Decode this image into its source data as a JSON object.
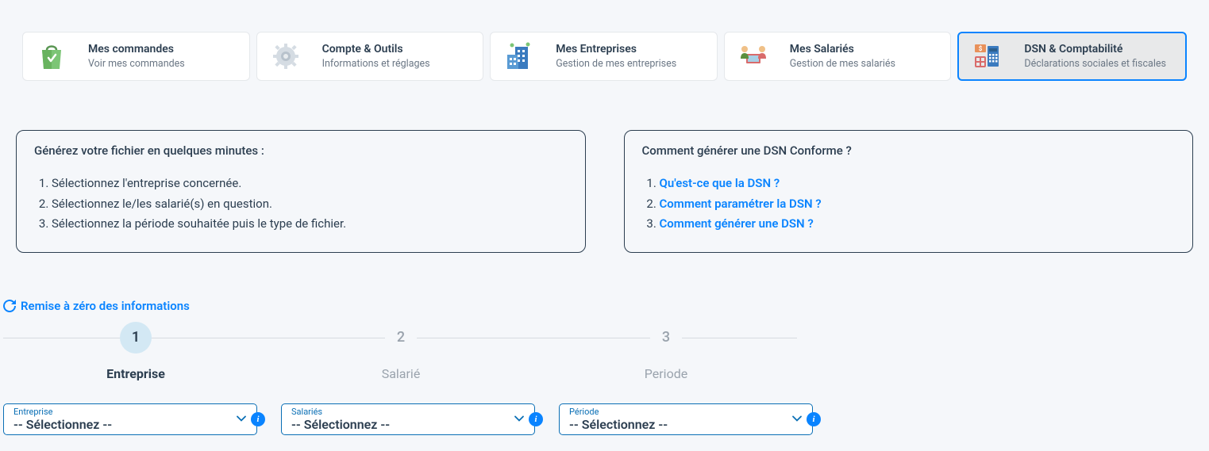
{
  "tabs": [
    {
      "title": "Mes commandes",
      "sub": "Voir mes commandes"
    },
    {
      "title": "Compte & Outils",
      "sub": "Informations et réglages"
    },
    {
      "title": "Mes Entreprises",
      "sub": "Gestion de mes entreprises"
    },
    {
      "title": "Mes Salariés",
      "sub": "Gestion de mes salariés"
    },
    {
      "title": "DSN & Comptabilité",
      "sub": "Déclarations sociales et fiscales"
    }
  ],
  "panel_left": {
    "heading": "Générez votre fichier en quelques minutes :",
    "items": [
      "Sélectionnez l'entreprise concernée.",
      "Sélectionnez le/les salarié(s) en question.",
      "Sélectionnez la période souhaitée puis le type de fichier."
    ]
  },
  "panel_right": {
    "heading": "Comment générer une DSN Conforme ?",
    "items": [
      "Qu'est-ce que la DSN ?",
      "Comment paramétrer la DSN ?",
      "Comment générer une DSN ?"
    ]
  },
  "reset_label": "Remise à zéro des informations",
  "steps": [
    {
      "num": "1",
      "label": "Entreprise"
    },
    {
      "num": "2",
      "label": "Salarié"
    },
    {
      "num": "3",
      "label": "Periode"
    }
  ],
  "selects": [
    {
      "label": "Entreprise",
      "value": "-- Sélectionnez --"
    },
    {
      "label": "Salariés",
      "value": "-- Sélectionnez --"
    },
    {
      "label": "Période",
      "value": "-- Sélectionnez --"
    }
  ]
}
